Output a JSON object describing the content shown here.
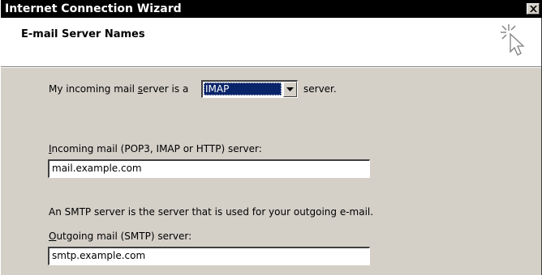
{
  "window": {
    "title": "Internet Connection Wizard",
    "close_icon": "close-icon"
  },
  "header": {
    "title": "E-mail Server Names",
    "icon": "wizard-sparkle-cursor-icon"
  },
  "incoming_type": {
    "label_prefix": "My incoming mail ",
    "label_underlined": "s",
    "label_rest": "erver is a",
    "selected_value": "IMAP",
    "suffix": "server."
  },
  "incoming_server": {
    "label_underlined": "I",
    "label_rest": "ncoming mail (POP3, IMAP or HTTP) server:",
    "value": "mail.example.com"
  },
  "smtp_info": {
    "text": "An SMTP server is the server that is used for your outgoing e-mail."
  },
  "outgoing_server": {
    "label_underlined": "O",
    "label_rest": "utgoing mail (SMTP) server:",
    "value": "smtp.example.com"
  }
}
